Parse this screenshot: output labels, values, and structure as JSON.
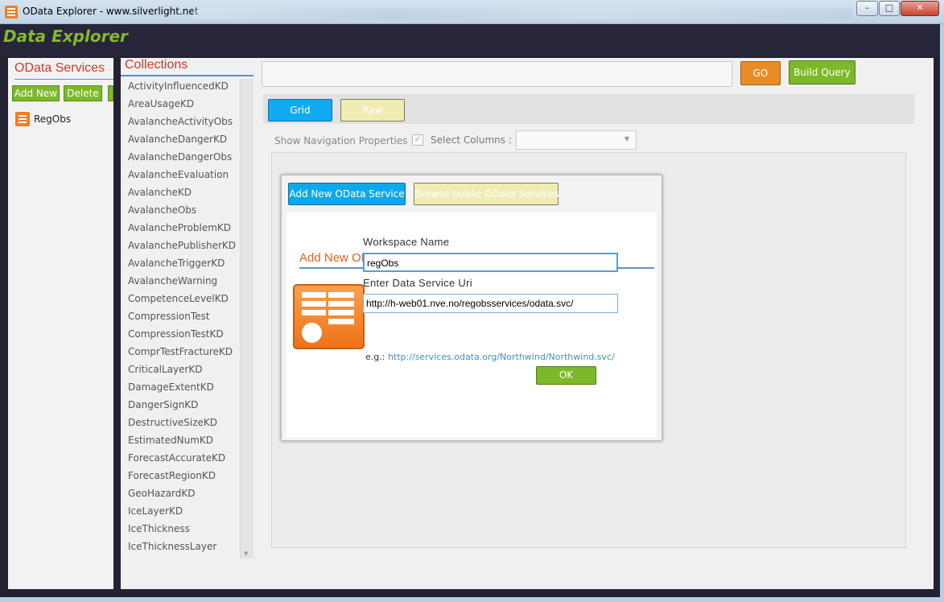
{
  "window": {
    "title": "OData Explorer - www.silverlight.net",
    "min_glyph": "–",
    "max_glyph": "□",
    "close_glyph": "✕"
  },
  "app": {
    "brand": "Data Explorer"
  },
  "services": {
    "title": "OData Services",
    "add_label": "Add New",
    "delete_label": "Delete",
    "items": [
      {
        "label": "RegObs",
        "icon": "table-icon"
      }
    ]
  },
  "collections": {
    "title": "Collections",
    "items": [
      "ActivityInfluencedKD",
      "AreaUsageKD",
      "AvalancheActivityObs",
      "AvalancheDangerKD",
      "AvalancheDangerObs",
      "AvalancheEvaluation",
      "AvalancheKD",
      "AvalancheObs",
      "AvalancheProblemKD",
      "AvalanchePublisherKD",
      "AvalancheTriggerKD",
      "AvalancheWarning",
      "CompetenceLevelKD",
      "CompressionTest",
      "CompressionTestKD",
      "ComprTestFractureKD",
      "CriticalLayerKD",
      "DamageExtentKD",
      "DangerSignKD",
      "DestructiveSizeKD",
      "EstimatedNumKD",
      "ForecastAccurateKD",
      "ForecastRegionKD",
      "GeoHazardKD",
      "IceLayerKD",
      "IceThickness",
      "IceThicknessLayer"
    ]
  },
  "toolbar": {
    "query_value": "",
    "go_label": "GO",
    "build_query_label": "Build Query"
  },
  "view_tabs": {
    "grid_label": "Grid",
    "raw_label": "Raw"
  },
  "options": {
    "nav_props_label": "Show Navigation Properties  :",
    "nav_props_checked": true,
    "select_columns_label": "Select Columns :",
    "select_columns_value": ""
  },
  "dialog": {
    "tab_add_label": "Add New OData Service",
    "tab_browse_label": "Browse public OData Services",
    "heading": "Add New OData Workspace",
    "workspace_name_label": "Workspace Name",
    "workspace_name_value": "regObs",
    "uri_label": "Enter Data Service Uri",
    "uri_value": "http://h-web01.nve.no/regobsservices/odata.svc/",
    "example_prefix": "e.g.: ",
    "example_link": "http://services.odata.org/Northwind/Northwind.svc/",
    "ok_label": "OK"
  },
  "colors": {
    "accent_green": "#7cb92a",
    "accent_orange": "#e98b26",
    "accent_blue": "#0fa8ef",
    "heading_red": "#c83c2c",
    "heading_orange": "#e0601c"
  }
}
